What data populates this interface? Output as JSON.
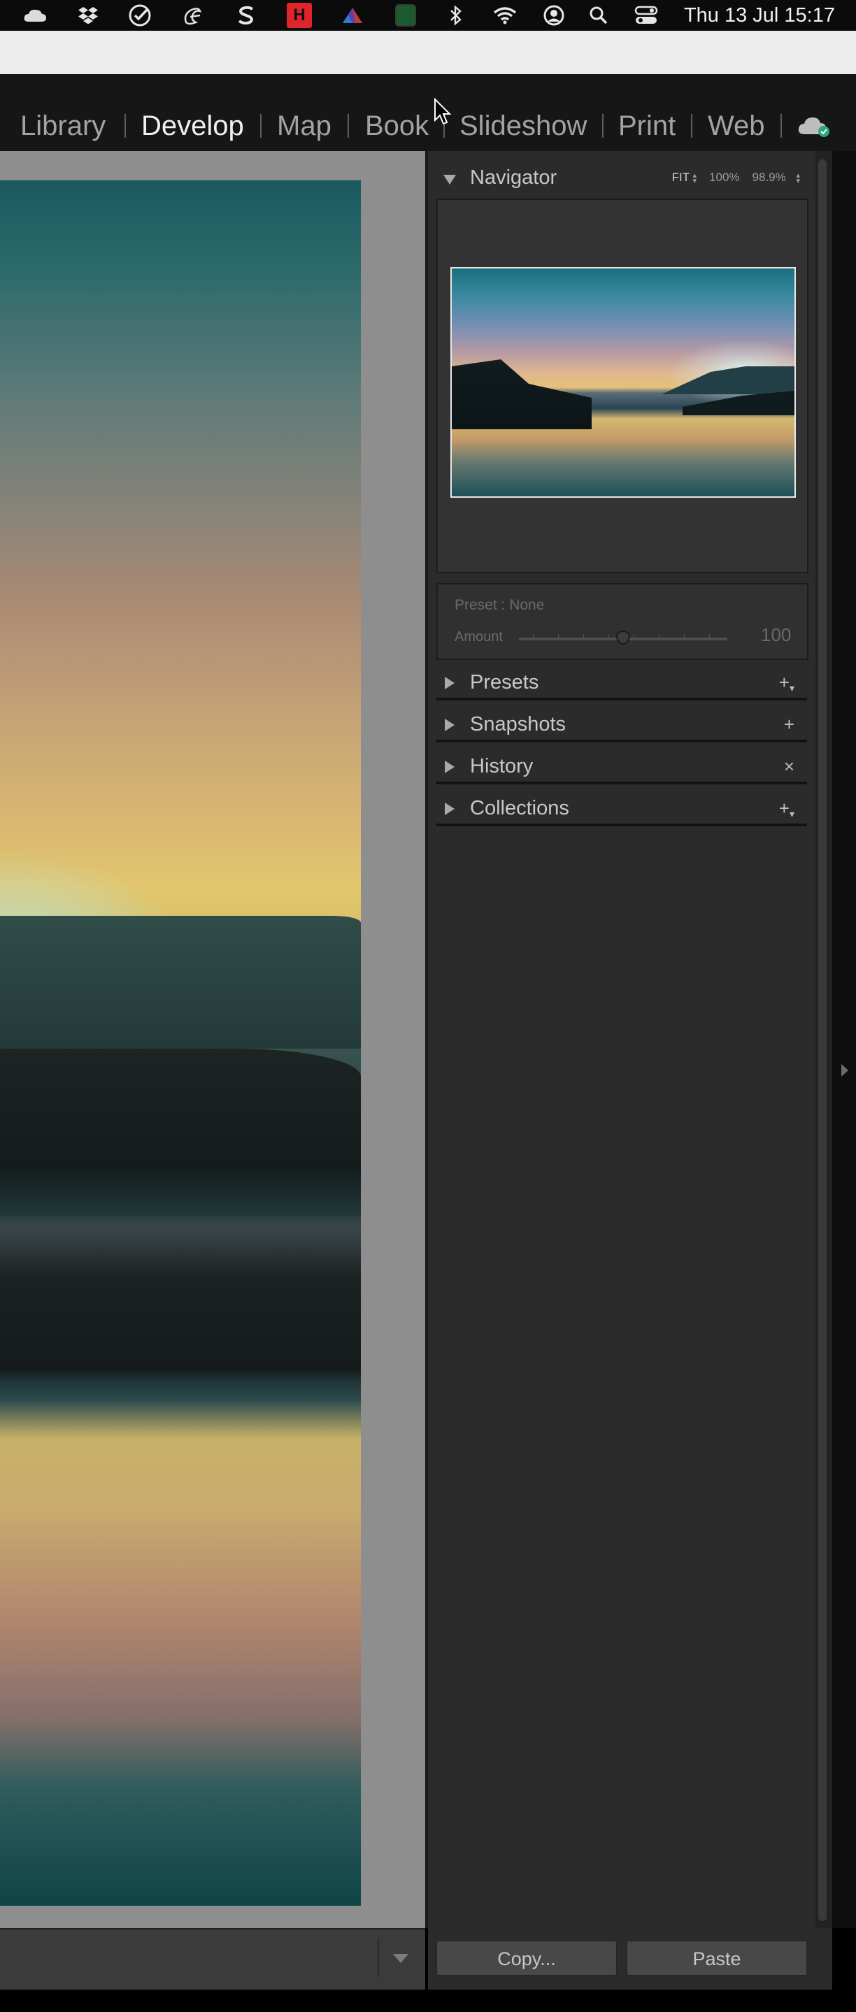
{
  "menubar": {
    "clock": "Thu 13 Jul  15:17",
    "icons": [
      "creative-cloud-icon",
      "dropbox-icon",
      "check-badge-icon",
      "script-icon",
      "s-app-icon",
      "red-app-icon",
      "color-app-icon",
      "terminal-app-icon",
      "bluetooth-icon",
      "wifi-icon",
      "user-icon",
      "search-icon",
      "control-center-icon"
    ]
  },
  "modules": [
    "Library",
    "Develop",
    "Map",
    "Book",
    "Slideshow",
    "Print",
    "Web"
  ],
  "active_module": "Develop",
  "navigator": {
    "title": "Navigator",
    "zoom_fit": "FIT",
    "zoom_100": "100%",
    "zoom_custom": "98.9%"
  },
  "preset_panel": {
    "preset_label": "Preset : None",
    "amount_label": "Amount",
    "amount_value": "100",
    "amount_fraction": 0.5
  },
  "panels": [
    {
      "label": "Presets",
      "action": "+"
    },
    {
      "label": "Snapshots",
      "action": "+"
    },
    {
      "label": "History",
      "action": "×"
    },
    {
      "label": "Collections",
      "action": "+"
    }
  ],
  "buttons": {
    "copy": "Copy...",
    "paste": "Paste"
  },
  "colors": {
    "panel_bg": "#2b2b2b",
    "module_active": "#f0f0f0",
    "module_inactive": "#a3a3a3"
  }
}
